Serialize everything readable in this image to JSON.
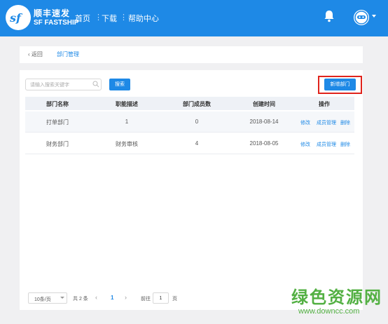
{
  "brand": {
    "cn": "顺丰速发",
    "en": "SF FASTSHIP",
    "logo_text": "sf"
  },
  "nav": {
    "home": "首页",
    "download": "下载",
    "help": "帮助中心"
  },
  "breadcrumb": {
    "back": "返回",
    "current": "部门管理"
  },
  "toolbar": {
    "search_placeholder": "请输入搜索关键字",
    "search_button": "搜索",
    "add_button": "新增部门"
  },
  "table": {
    "headers": [
      "部门名称",
      "职能描述",
      "部门成员数",
      "创建时间",
      "操作"
    ],
    "rows": [
      {
        "name": "打单部门",
        "desc": "1",
        "members": "0",
        "created": "2018-08-14"
      },
      {
        "name": "财务部门",
        "desc": "财务审核",
        "members": "4",
        "created": "2018-08-05"
      }
    ],
    "actions": {
      "edit": "修改",
      "members": "成员管理",
      "delete": "删除"
    }
  },
  "pagination": {
    "page_size": "10条/页",
    "total": "共 2 条",
    "current_page": "1",
    "goto_label": "前往",
    "goto_value": "1",
    "page_suffix": "页"
  },
  "watermark": {
    "title": "绿色资源网",
    "url": "www.downcc.com"
  },
  "colors": {
    "accent": "#1e89e6",
    "highlight": "#e0231c",
    "watermark": "#53b043"
  }
}
